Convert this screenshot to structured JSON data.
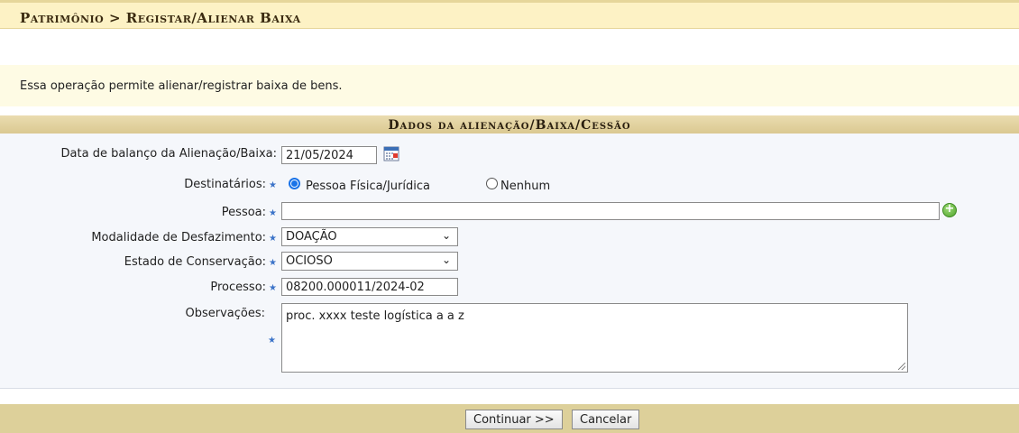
{
  "breadcrumb": {
    "text": "Patrimônio > Registar/Alienar Baixa"
  },
  "info_text": "Essa operação permite alienar/registrar baixa de bens.",
  "section_title": "Dados da alienação/Baixa/Cessão",
  "form": {
    "data_balanco": {
      "label": "Data de balanço da Alienação/Baixa:",
      "value": "21/05/2024"
    },
    "destinatarios": {
      "label": "Destinatários:",
      "options": [
        "Pessoa Física/Jurídica",
        "Nenhum"
      ],
      "selected": "Pessoa Física/Jurídica"
    },
    "pessoa": {
      "label": "Pessoa:",
      "value": ""
    },
    "modalidade": {
      "label": "Modalidade de Desfazimento:",
      "value": "DOAÇÃO"
    },
    "estado": {
      "label": "Estado de Conservação:",
      "value": "OCIOSO"
    },
    "processo": {
      "label": "Processo:",
      "value": "08200.000011/2024-02"
    },
    "observacoes": {
      "label": "Observações:",
      "value": "proc. xxxx teste logística a a z"
    }
  },
  "buttons": {
    "continuar": "Continuar >>",
    "cancelar": "Cancelar"
  },
  "icons": {
    "required": "star-icon",
    "calendar": "calendar-icon",
    "add": "add-circle-icon",
    "dropdown": "chevron-down-icon"
  },
  "colors": {
    "title_bg": "#fdf2c5",
    "section_bg": "#d9c78e",
    "footer_bg": "#ddd09a",
    "form_bg": "#f5f7fb",
    "required_star": "#3b73c8",
    "radio_accent": "#1a73e8"
  }
}
